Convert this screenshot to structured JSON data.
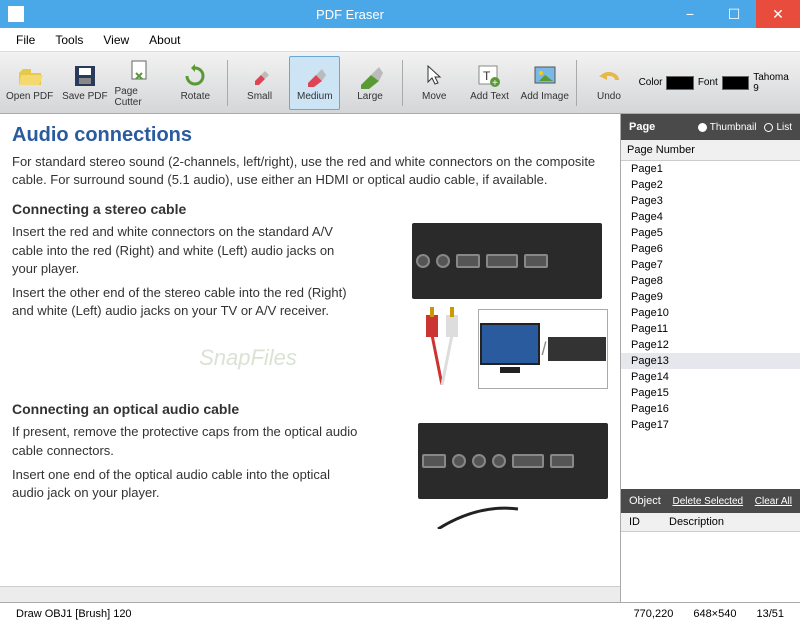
{
  "window": {
    "title": "PDF Eraser"
  },
  "menu": {
    "file": "File",
    "tools": "Tools",
    "view": "View",
    "about": "About"
  },
  "toolbar": {
    "open": "Open PDF",
    "save": "Save PDF",
    "cutter": "Page Cutter",
    "rotate": "Rotate",
    "small": "Small",
    "medium": "Medium",
    "large": "Large",
    "move": "Move",
    "addtext": "Add Text",
    "addimage": "Add Image",
    "undo": "Undo",
    "color_lbl": "Color",
    "font_lbl": "Font",
    "font_val": "Tahoma 9"
  },
  "doc": {
    "h1": "Audio connections",
    "p1": "For standard stereo sound (2-channels, left/right), use the red and white connectors on the composite cable. For surround sound (5.1 audio), use either an HDMI or optical audio cable, if available.",
    "sub1": "Connecting a stereo cable",
    "p2": "Insert the red and white connectors on the standard A/V cable into the red (Right) and white (Left) audio jacks on your player.",
    "p3": "Insert the other end of the stereo cable into the red (Right) and white (Left) audio jacks on your TV or A/V receiver.",
    "sub2": "Connecting an optical audio cable",
    "p4": "If present, remove the protective caps from the optical audio cable connectors.",
    "p5": "Insert one end of the optical audio cable into the optical audio jack on your player.",
    "watermark": "SnapFiles"
  },
  "sidebar": {
    "page_hdr": "Page",
    "thumb": "Thumbnail",
    "list": "List",
    "col_head": "Page Number",
    "pages": [
      "Page1",
      "Page2",
      "Page3",
      "Page4",
      "Page5",
      "Page6",
      "Page7",
      "Page8",
      "Page9",
      "Page10",
      "Page11",
      "Page12",
      "Page13",
      "Page14",
      "Page15",
      "Page16",
      "Page17"
    ],
    "obj_hdr": "Object",
    "del": "Delete Selected",
    "clear": "Clear All",
    "obj_id": "ID",
    "obj_desc": "Description"
  },
  "status": {
    "draw": "Draw OBJ1 [Brush] 120",
    "coords": "770,220",
    "dims": "648×540",
    "pg": "13/51"
  }
}
